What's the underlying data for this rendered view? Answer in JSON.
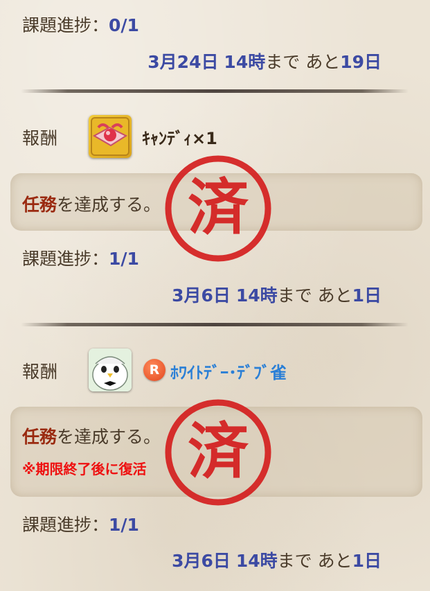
{
  "labels": {
    "progress": "課題進捗：",
    "reward": "報酬",
    "until": "まで",
    "remaining": "あと"
  },
  "sections": [
    {
      "progress_value": "0/1",
      "deadline": {
        "date": "3月24日",
        "hour": "14時",
        "remaining": "19日"
      }
    },
    {
      "reward": {
        "icon": "candy-icon",
        "name": "ｷｬﾝﾃﾞｨ×1"
      },
      "task": {
        "emphasis": "任務",
        "rest": "を達成する。"
      },
      "stamp": "済",
      "progress_value": "1/1",
      "deadline": {
        "date": "3月6日",
        "hour": "14時",
        "remaining": "1日"
      }
    },
    {
      "reward": {
        "badge": "R",
        "icon": "debu-sparrow-icon",
        "name": "ﾎﾜｲﾄﾃﾞｰ･ﾃﾞﾌﾞ雀"
      },
      "task": {
        "emphasis": "任務",
        "rest": "を達成する。",
        "note": "※期限終了後に復活"
      },
      "stamp": "済",
      "progress_value": "1/1",
      "deadline": {
        "date": "3月6日",
        "hour": "14時",
        "remaining": "1日"
      }
    }
  ],
  "colors": {
    "blue": "#3c4aa3",
    "stamp_red": "#d41e1e",
    "note_red": "#ee1111",
    "reward_link": "#2a7fd6"
  }
}
